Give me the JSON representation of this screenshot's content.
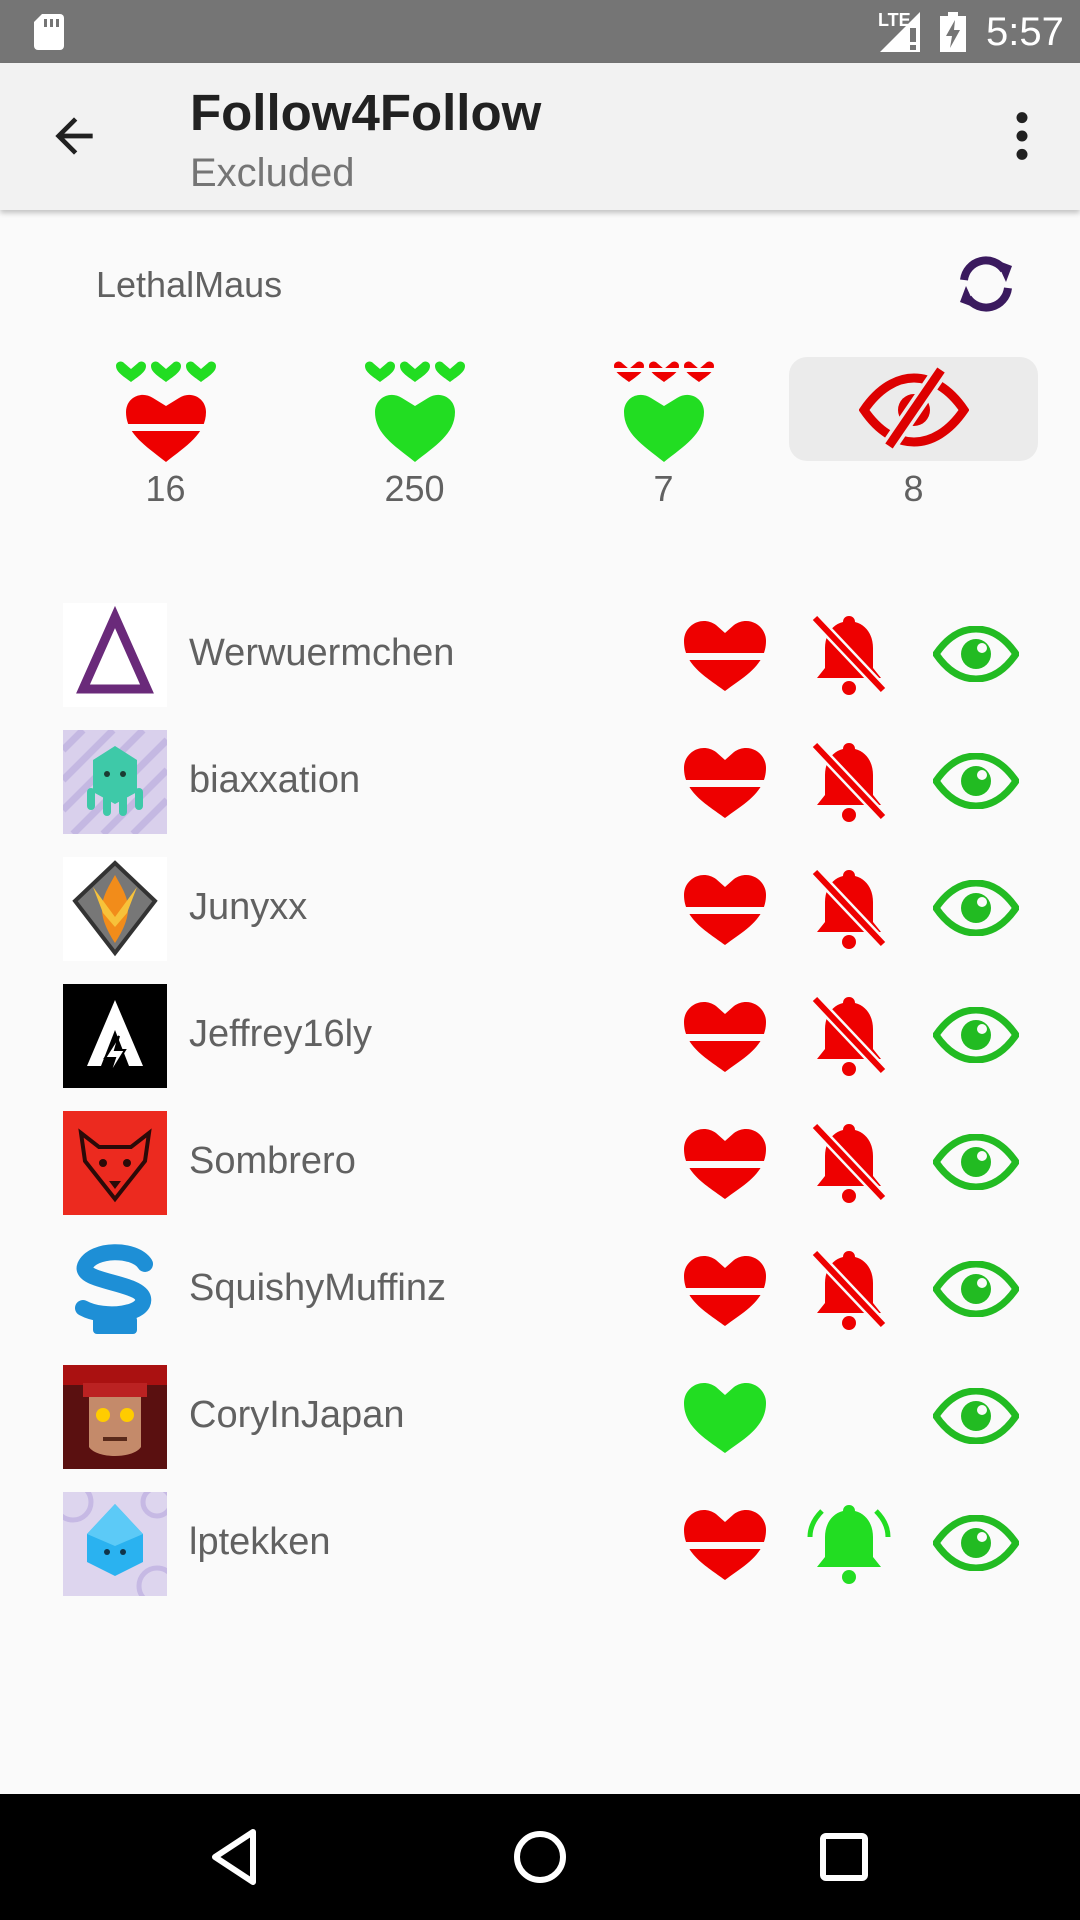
{
  "status_bar": {
    "time": "5:57",
    "network": "LTE"
  },
  "app_bar": {
    "title": "Follow4Follow",
    "subtitle": "Excluded"
  },
  "account": {
    "name": "LethalMaus"
  },
  "stats": [
    {
      "icon": "red-heart-three-green-hearts-icon",
      "count": "16"
    },
    {
      "icon": "green-heart-three-green-hearts-icon",
      "count": "250"
    },
    {
      "icon": "green-heart-three-red-hearts-icon",
      "count": "7"
    },
    {
      "icon": "eye-off-icon",
      "count": "8",
      "selected": true
    }
  ],
  "users": [
    {
      "name": "Werwuermchen",
      "follow": "red-heart",
      "notify": "bell-off",
      "visible": "eye"
    },
    {
      "name": "biaxxation",
      "follow": "red-heart",
      "notify": "bell-off",
      "visible": "eye"
    },
    {
      "name": "Junyxx",
      "follow": "red-heart",
      "notify": "bell-off",
      "visible": "eye"
    },
    {
      "name": "Jeffrey16ly",
      "follow": "red-heart",
      "notify": "bell-off",
      "visible": "eye"
    },
    {
      "name": "Sombrero",
      "follow": "red-heart",
      "notify": "bell-off",
      "visible": "eye"
    },
    {
      "name": "SquishyMuffinz",
      "follow": "red-heart",
      "notify": "bell-off",
      "visible": "eye"
    },
    {
      "name": "CoryInJapan",
      "follow": "green-heart",
      "notify": "none",
      "visible": "eye"
    },
    {
      "name": "lptekken",
      "follow": "red-heart",
      "notify": "bell-ringing",
      "visible": "eye"
    }
  ],
  "colors": {
    "red": "#ee0000",
    "green": "#22dd22",
    "refresh": "#3a1a5e",
    "status_bar": "#757575",
    "app_bar": "#f2f2f2"
  }
}
